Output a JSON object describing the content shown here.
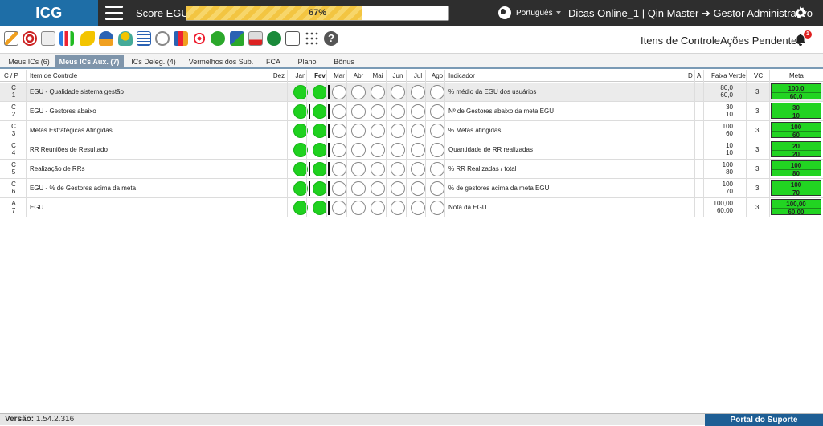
{
  "topbar": {
    "logo": "ICG",
    "score_label": "Score EGU:",
    "score_text": "67%",
    "score_value": 67,
    "language": "Português",
    "user_info": "Dicas Online_1  |  Qin Master ➔ Gestor Administrativo"
  },
  "toolbar": {
    "itens_controle": "Itens de Controle",
    "acoes_pendentes": "Ações Pendentes",
    "bell_badge": "1"
  },
  "tabs": [
    {
      "label": "Meus ICs (6)",
      "active": false
    },
    {
      "label": "Meus ICs Aux. (7)",
      "active": true
    },
    {
      "label": "ICs Deleg. (4)",
      "active": false
    },
    {
      "label": "Vermelhos dos Sub.",
      "active": false
    },
    {
      "label": "FCA",
      "active": false
    },
    {
      "label": "Plano",
      "active": false
    },
    {
      "label": "Bônus",
      "active": false
    }
  ],
  "headers": {
    "cp": "C / P",
    "item": "Item de Controle",
    "months": [
      "Dez",
      "Jan",
      "Fev",
      "Mar",
      "Abr",
      "Mai",
      "Jun",
      "Jul",
      "Ago"
    ],
    "indicador": "Indicador",
    "d": "D",
    "a": "A",
    "faixa": "Faixa Verde",
    "vc": "VC",
    "meta": "Meta"
  },
  "rows": [
    {
      "cp_letter": "C",
      "cp_num": "1",
      "item": "EGU - Qualidade sistema gestão",
      "indicador": "% médio da EGU dos usuários",
      "faixa1": "80,0",
      "faixa2": "60,0",
      "vc": "3",
      "meta1": "100,0",
      "meta2": "60,0",
      "bar_after_jan": false
    },
    {
      "cp_letter": "C",
      "cp_num": "2",
      "item": "EGU - Gestores abaixo",
      "indicador": "Nº de Gestores abaixo da meta EGU",
      "faixa1": "30",
      "faixa2": "10",
      "vc": "3",
      "meta1": "30",
      "meta2": "10",
      "bar_after_jan": true
    },
    {
      "cp_letter": "C",
      "cp_num": "3",
      "item": "Metas Estratégicas Atingidas",
      "indicador": "% Metas atingidas",
      "faixa1": "100",
      "faixa2": "60",
      "vc": "3",
      "meta1": "100",
      "meta2": "60",
      "bar_after_jan": false
    },
    {
      "cp_letter": "C",
      "cp_num": "4",
      "item": "RR Reuniões de Resultado",
      "indicador": "Quantidade de RR realizadas",
      "faixa1": "10",
      "faixa2": "10",
      "vc": "3",
      "meta1": "20",
      "meta2": "20",
      "bar_after_jan": false
    },
    {
      "cp_letter": "C",
      "cp_num": "5",
      "item": "Realização de RRs",
      "indicador": "% RR Realizadas / total",
      "faixa1": "100",
      "faixa2": "80",
      "vc": "3",
      "meta1": "100",
      "meta2": "80",
      "bar_after_jan": true
    },
    {
      "cp_letter": "C",
      "cp_num": "6",
      "item": "EGU - % de Gestores acima da meta",
      "indicador": "% de gestores acima da meta EGU",
      "faixa1": "100",
      "faixa2": "70",
      "vc": "3",
      "meta1": "100",
      "meta2": "70",
      "bar_after_jan": true
    },
    {
      "cp_letter": "A",
      "cp_num": "7",
      "item": "EGU",
      "indicador": "Nota da EGU",
      "faixa1": "100,00",
      "faixa2": "60,00",
      "vc": "3",
      "meta1": "100,00",
      "meta2": "60,00",
      "bar_after_jan": false
    }
  ],
  "footer": {
    "version_label": "Versão:",
    "version_value": "1.54.2.316",
    "portal": "Portal do Suporte"
  }
}
